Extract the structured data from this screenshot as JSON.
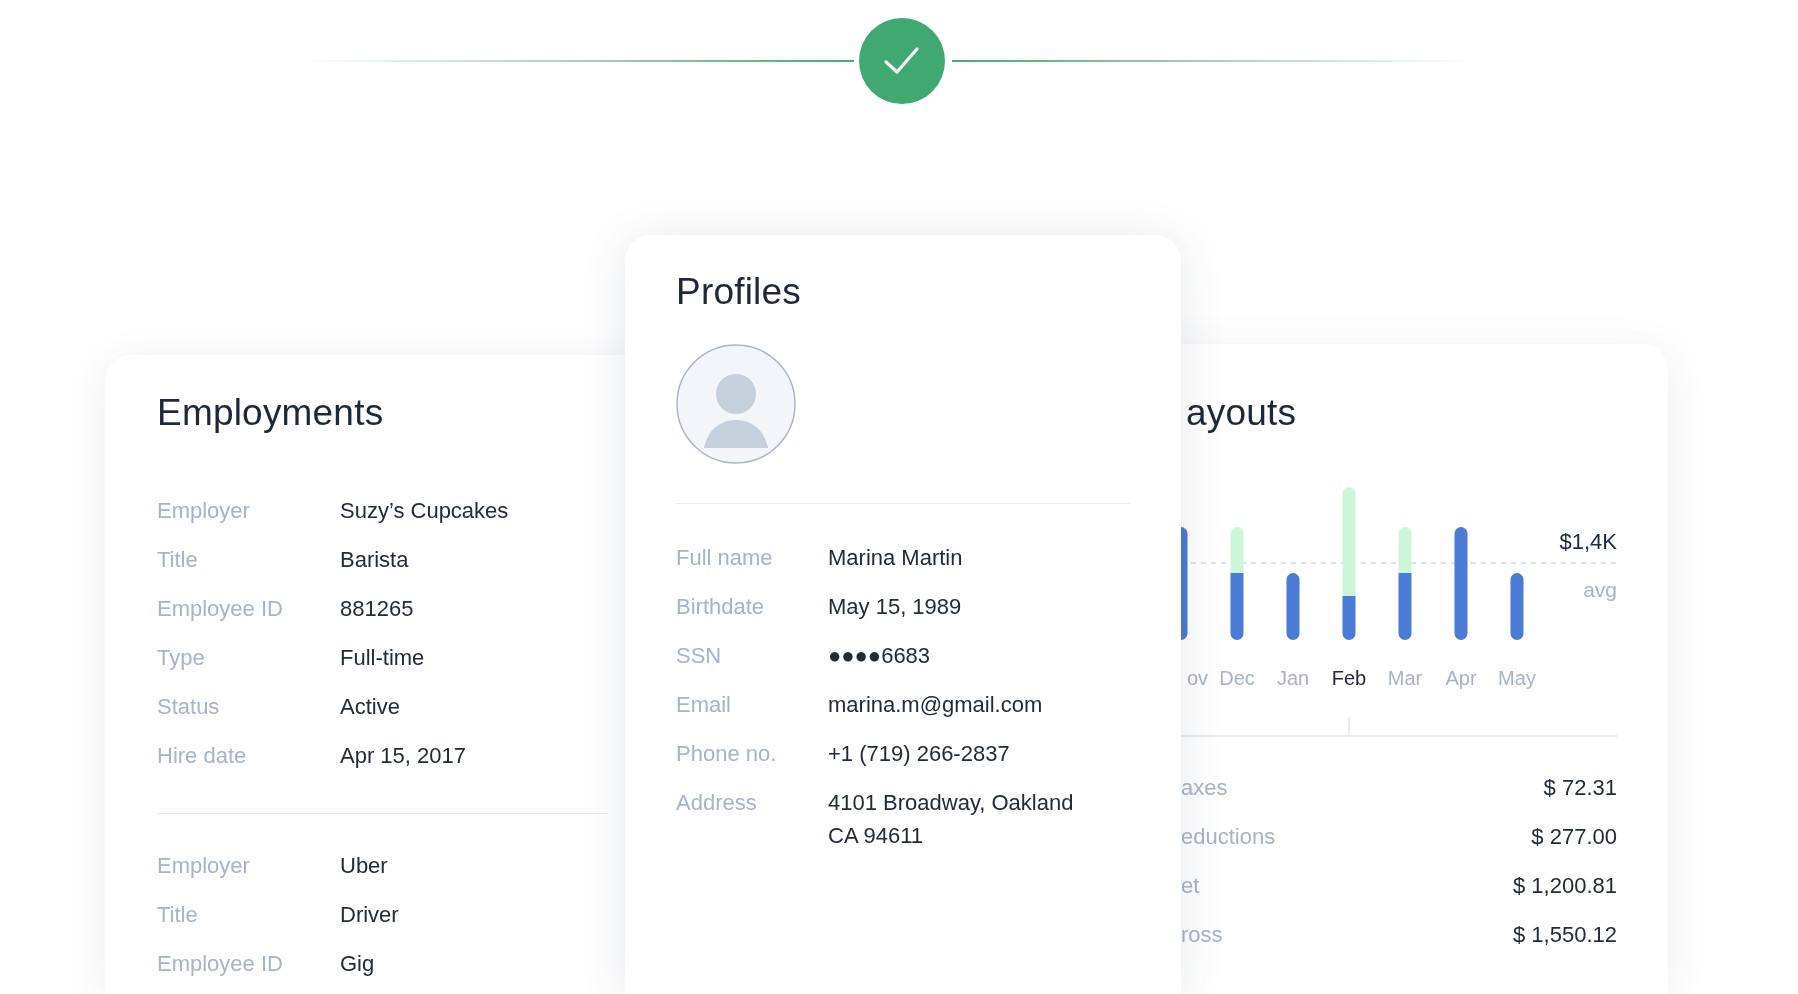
{
  "employments": {
    "title": "Employments",
    "groups": [
      {
        "fields": [
          {
            "label": "Employer",
            "value": "Suzy’s Cupcakes"
          },
          {
            "label": "Title",
            "value": "Barista"
          },
          {
            "label": "Employee ID",
            "value": "881265"
          },
          {
            "label": "Type",
            "value": "Full-time"
          },
          {
            "label": "Status",
            "value": "Active"
          },
          {
            "label": "Hire date",
            "value": "Apr 15, 2017"
          }
        ]
      },
      {
        "fields": [
          {
            "label": "Employer",
            "value": "Uber"
          },
          {
            "label": "Title",
            "value": "Driver"
          },
          {
            "label": "Employee ID",
            "value": "Gig"
          }
        ]
      }
    ]
  },
  "profiles": {
    "title": "Profiles",
    "fields": [
      {
        "label": "Full name",
        "value": "Marina Martin"
      },
      {
        "label": "Birthdate",
        "value": "May 15, 1989"
      },
      {
        "label": "SSN",
        "value": "●●●●6683"
      },
      {
        "label": "Email",
        "value": "marina.m@gmail.com"
      },
      {
        "label": "Phone no.",
        "value": "+1 (719) 266-2837"
      },
      {
        "label": "Address",
        "value": "4101 Broadway, Oakland\nCA 94611"
      }
    ]
  },
  "payouts": {
    "title": "ayouts",
    "chart": {
      "months": [
        {
          "label": "ov",
          "selected": false
        },
        {
          "label": "Dec",
          "selected": false
        },
        {
          "label": "Jan",
          "selected": false
        },
        {
          "label": "Feb",
          "selected": true
        },
        {
          "label": "Mar",
          "selected": false
        },
        {
          "label": "Apr",
          "selected": false
        },
        {
          "label": "May",
          "selected": false
        }
      ],
      "average_value": "$1,4K",
      "average_label": "avg"
    },
    "rows": [
      {
        "label": "axes",
        "amount": "$ 72.31"
      },
      {
        "label": "eductions",
        "amount": "$ 277.00"
      },
      {
        "label": "et",
        "amount": "$ 1,200.81"
      },
      {
        "label": "ross",
        "amount": "$ 1,550.12"
      }
    ]
  }
}
